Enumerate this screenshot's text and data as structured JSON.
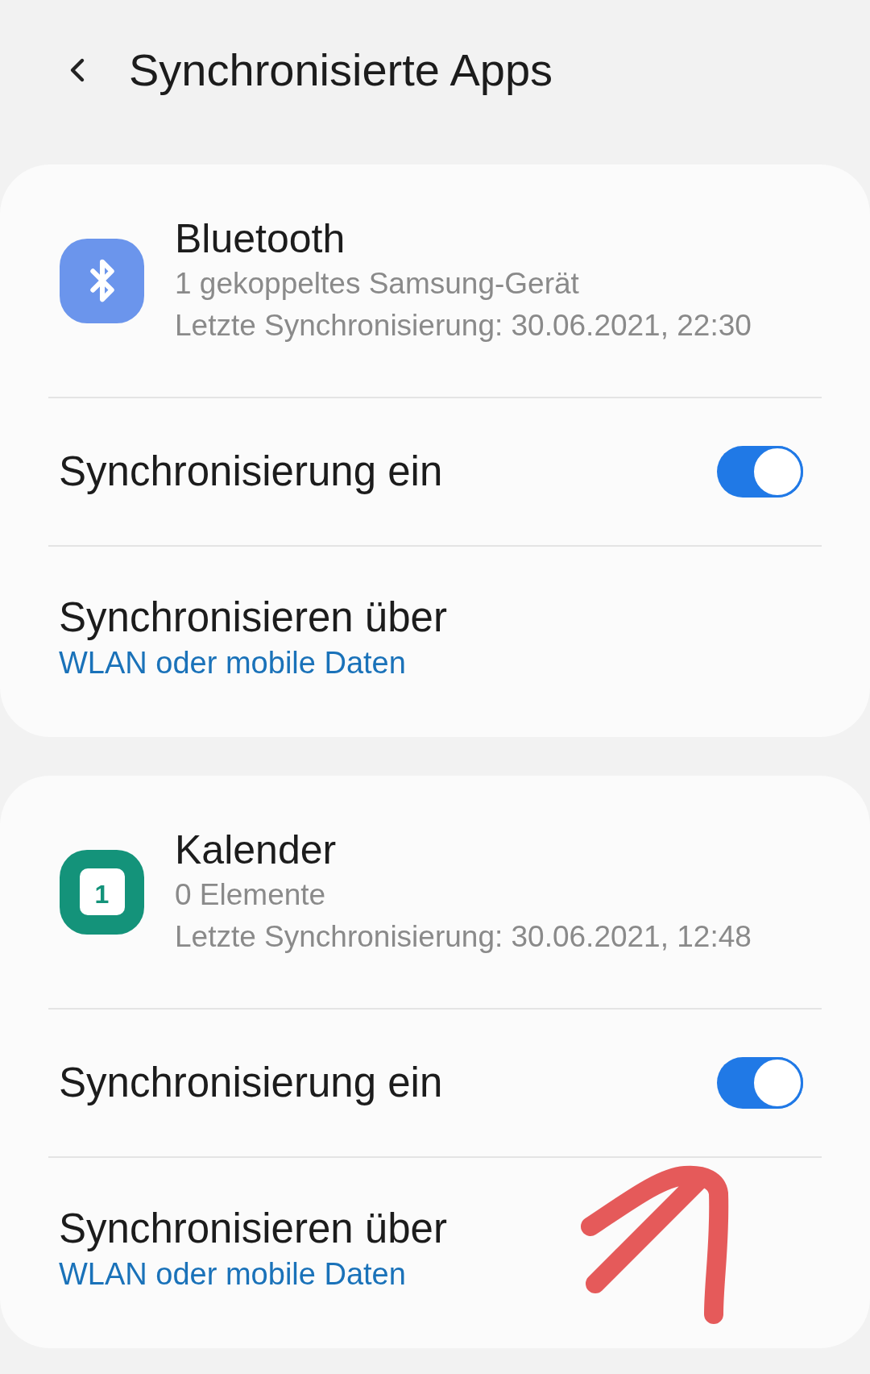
{
  "header": {
    "title": "Synchronisierte Apps"
  },
  "apps": [
    {
      "kind": "bluetooth",
      "name": "Bluetooth",
      "detail": "1 gekoppeltes Samsung-Gerät",
      "last_sync": "Letzte Synchronisierung: 30.06.2021, 22:30",
      "sync_label": "Synchronisierung ein",
      "sync_on": true,
      "via_label": "Synchronisieren über",
      "via_value": "WLAN oder mobile Daten"
    },
    {
      "kind": "calendar",
      "icon_text": "1",
      "name": "Kalender",
      "detail": "0 Elemente",
      "last_sync": "Letzte Synchronisierung: 30.06.2021, 12:48",
      "sync_label": "Synchronisierung ein",
      "sync_on": true,
      "via_label": "Synchronisieren über",
      "via_value": "WLAN oder mobile Daten"
    }
  ]
}
